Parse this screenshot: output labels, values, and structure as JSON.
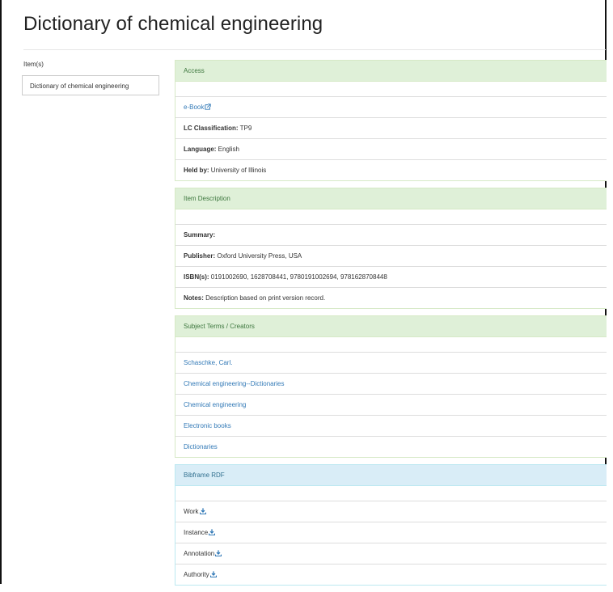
{
  "page": {
    "title": "Dictionary of chemical engineering"
  },
  "items": {
    "label": "Item(s)",
    "selected": "Dictionary of chemical engineering"
  },
  "access": {
    "heading": "Access",
    "ebook_link": "e-Book",
    "lc_label": "LC Classification:",
    "lc_value": " TP9",
    "language_label": "Language:",
    "language_value": " English",
    "held_label": "Held by:",
    "held_value": " University of Illinois"
  },
  "description": {
    "heading": "Item Description",
    "summary_label": "Summary:",
    "publisher_label": "Publisher:",
    "publisher_value": " Oxford University Press, USA",
    "isbn_label": "ISBN(s):",
    "isbn_value": " 0191002690, 1628708441, 9780191002694, 9781628708448",
    "notes_label": "Notes:",
    "notes_value": " Description based on print version record."
  },
  "subjects": {
    "heading": "Subject Terms / Creators",
    "links": [
      "Schaschke, Carl.",
      "Chemical engineering--Dictionaries",
      "Chemical engineering",
      "Electronic books",
      "Dictionaries"
    ]
  },
  "bibframe": {
    "heading": "Bibframe RDF",
    "items": [
      "Work",
      "Instance",
      "Annotation",
      "Authority"
    ]
  },
  "icons": {
    "external": "external-link-icon",
    "download": "download-icon"
  },
  "colors": {
    "panel_success_bg": "#dff0d8",
    "panel_info_bg": "#d9edf7",
    "link": "#337ab7"
  }
}
